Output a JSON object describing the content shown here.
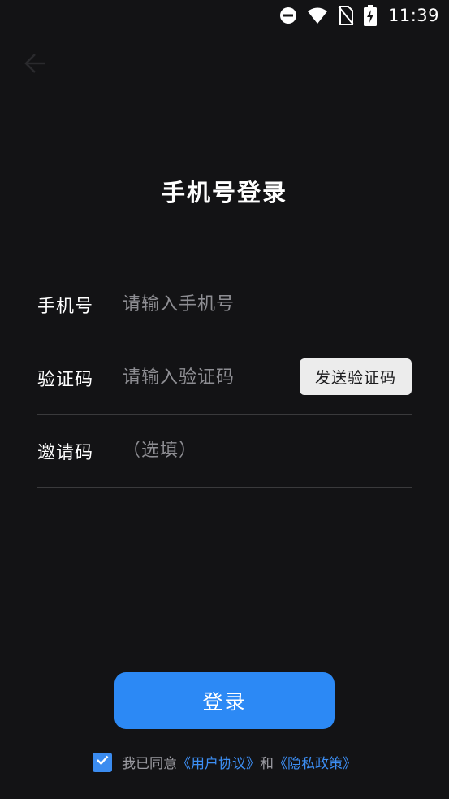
{
  "status_bar": {
    "time": "11:39",
    "icons": [
      "do-not-disturb-icon",
      "wifi-icon",
      "no-sim-icon",
      "battery-charging-icon"
    ]
  },
  "nav": {
    "back_icon": "arrow-left-icon"
  },
  "page": {
    "title": "手机号登录"
  },
  "form": {
    "phone": {
      "label": "手机号",
      "placeholder": "请输入手机号",
      "value": ""
    },
    "code": {
      "label": "验证码",
      "placeholder": "请输入验证码",
      "value": "",
      "send_button_label": "发送验证码"
    },
    "invite": {
      "label": "邀请码",
      "placeholder": "（选填）",
      "value": ""
    }
  },
  "login_button_label": "登录",
  "agreement": {
    "checked": true,
    "prefix": "我已同意",
    "user_agreement": "《用户协议》",
    "and": "和",
    "privacy_policy": "《隐私政策》"
  },
  "colors": {
    "background": "#131315",
    "accent": "#2c89f5",
    "link": "#3d8ff5",
    "placeholder": "#8e8e93",
    "divider": "#3a3a3c"
  }
}
